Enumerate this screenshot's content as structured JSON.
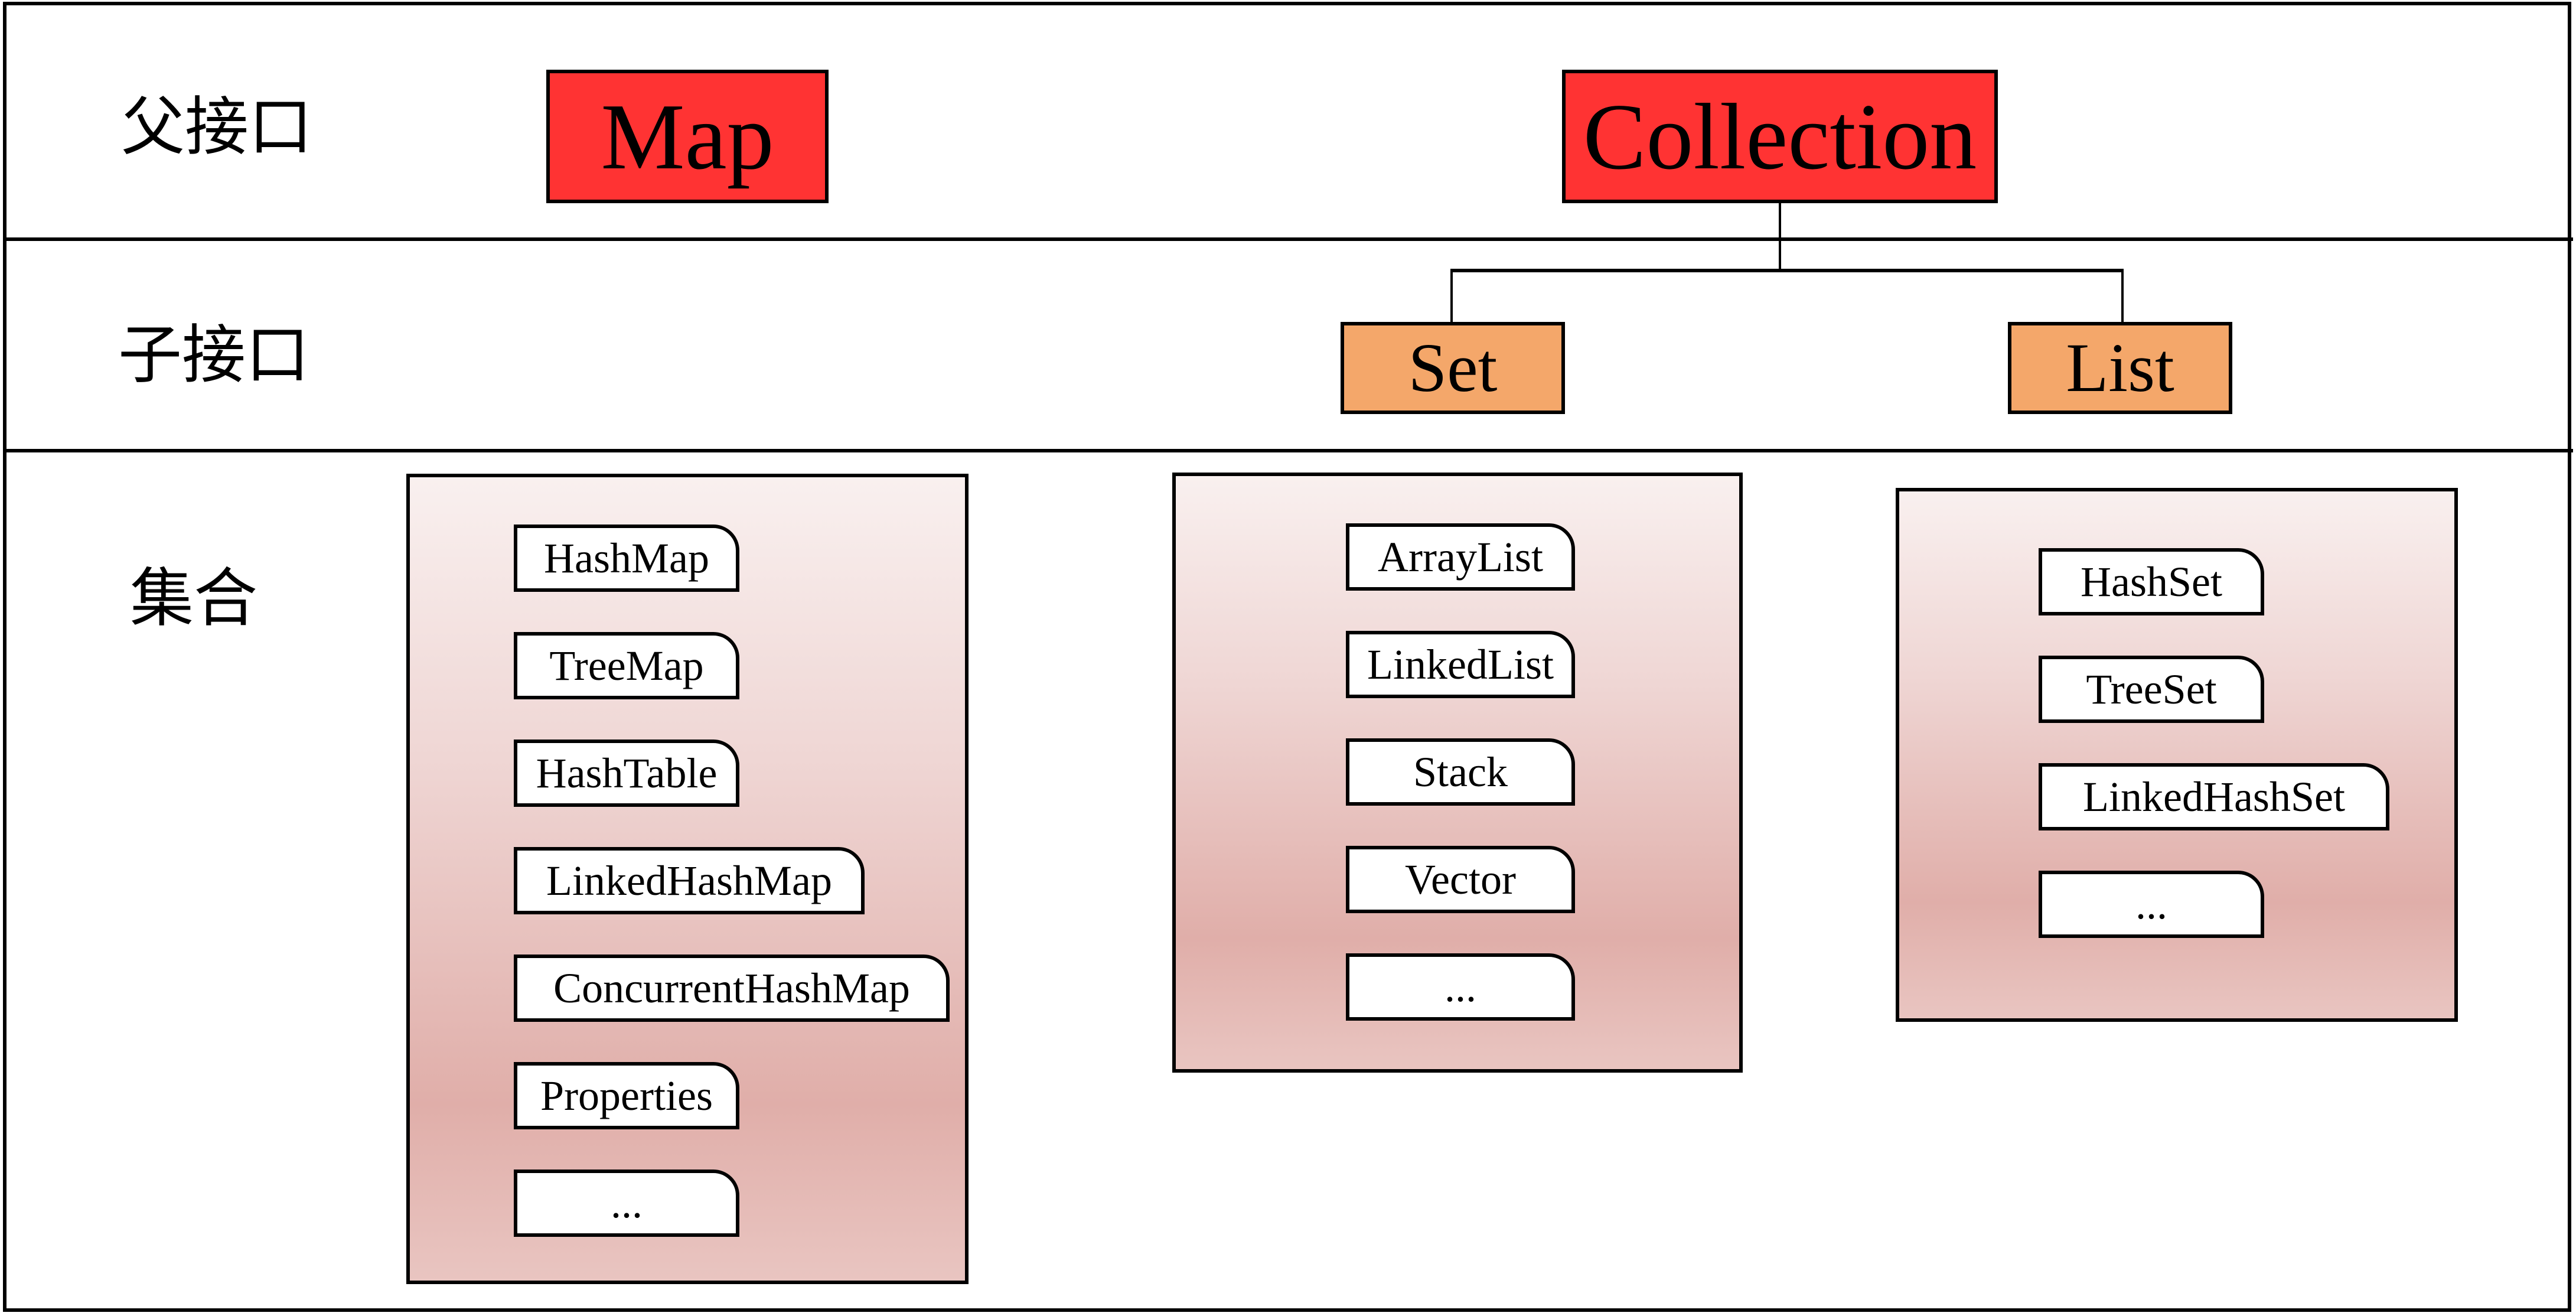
{
  "rows": [
    {
      "label": "父接口"
    },
    {
      "label": "子接口"
    },
    {
      "label": "集合"
    }
  ],
  "parent_interfaces": [
    {
      "name": "Map",
      "color": "#ff3333"
    },
    {
      "name": "Collection",
      "color": "#ff3333"
    }
  ],
  "child_interfaces": [
    {
      "name": "Set",
      "parent": "Collection",
      "color": "#f4a76a"
    },
    {
      "name": "List",
      "parent": "Collection",
      "color": "#f4a76a"
    }
  ],
  "collections": {
    "map_group": [
      "HashMap",
      "TreeMap",
      "HashTable",
      "LinkedHashMap",
      "ConcurrentHashMap",
      "Properties",
      "..."
    ],
    "list_group": [
      "ArrayList",
      "LinkedList",
      "Stack",
      "Vector",
      "..."
    ],
    "set_group": [
      "HashSet",
      "TreeSet",
      "LinkedHashSet",
      "..."
    ]
  },
  "colors": {
    "parent_fill": "#ff3333",
    "child_fill": "#f4a76a",
    "group_gradient_top": "#f9f0ef",
    "group_gradient_mid": "#e0aea9"
  }
}
